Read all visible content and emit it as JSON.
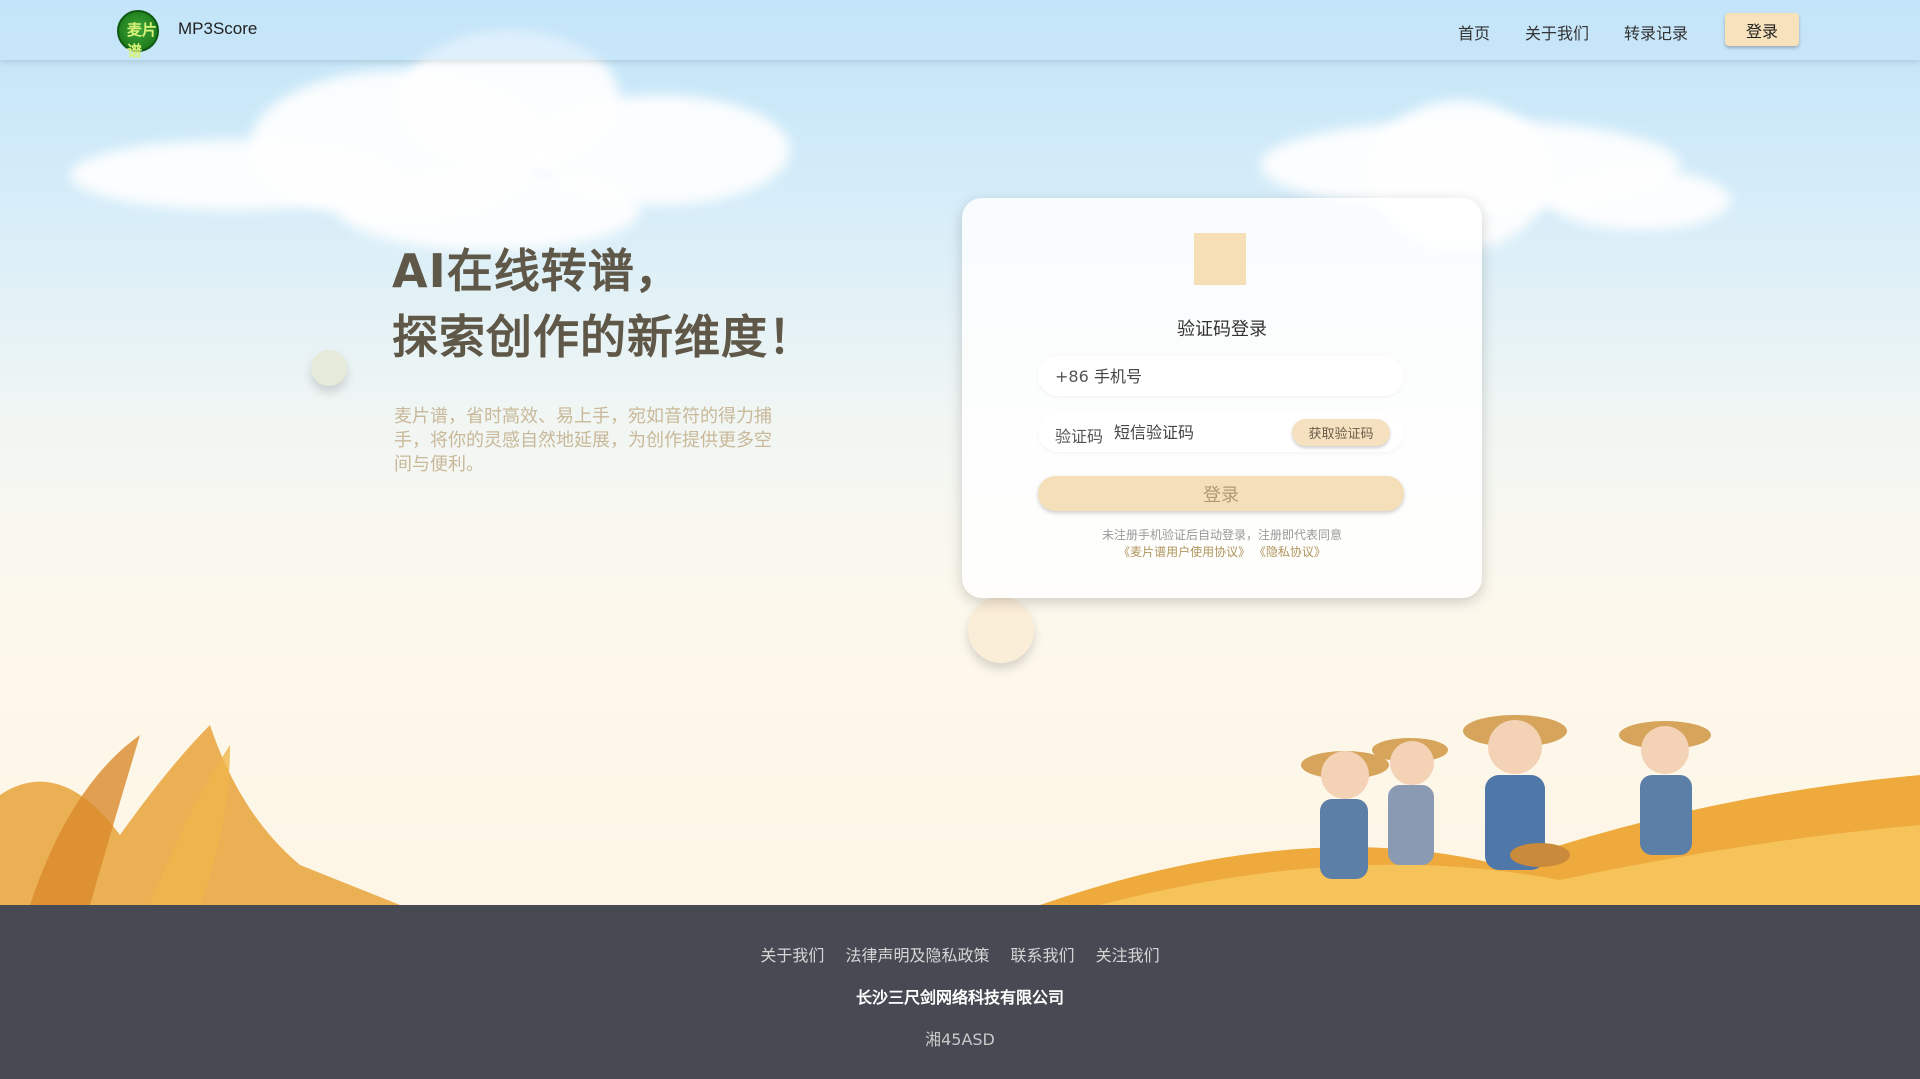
{
  "header": {
    "brand": "MP3Score",
    "logo_text": "麦片谱",
    "nav": [
      "首页",
      "关于我们",
      "转录记录"
    ],
    "login_label": "登录"
  },
  "hero": {
    "title_line1": "AI在线转谱，",
    "title_line2": "探索创作的新维度！",
    "description": "麦片谱，省时高效、易上手，宛如音符的得力捕手，将你的灵感自然地延展，为创作提供更多空间与便利。"
  },
  "login_card": {
    "title": "验证码登录",
    "phone_prefix": "+86",
    "phone_placeholder": "手机号",
    "code_label": "验证码",
    "code_placeholder": "短信验证码",
    "get_code_label": "获取验证码",
    "submit_label": "登录",
    "notice": "未注册手机验证后自动登录，注册即代表同意",
    "user_agreement": "《麦片谱用户使用协议》",
    "privacy_agreement": "《隐私协议》"
  },
  "footer": {
    "links": [
      "关于我们",
      "法律声明及隐私政策",
      "联系我们",
      "关注我们"
    ],
    "company": "长沙三尺剑网络科技有限公司",
    "icp": "湘45ASD"
  },
  "colors": {
    "accent": "#f6dfb6",
    "heading": "#5f5848",
    "footer_bg": "#474a53"
  }
}
